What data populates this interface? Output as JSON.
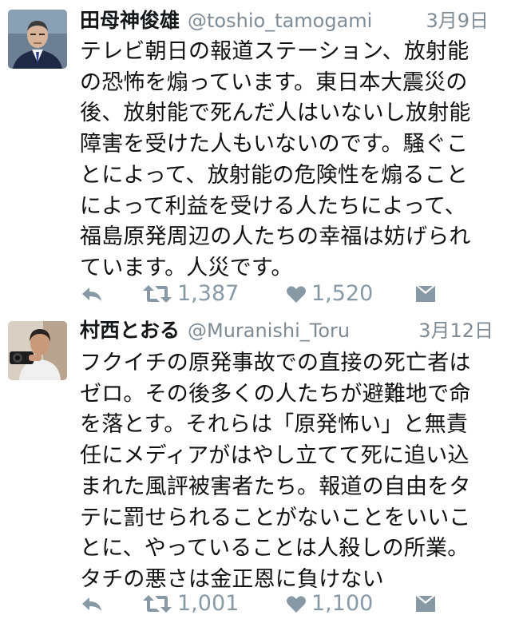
{
  "tweets": [
    {
      "name": "田母神俊雄",
      "handle": "@toshio_tamogami",
      "date": "3月9日",
      "body_lines": [
        "テレビ朝日の報道ステーション、放射能",
        "の恐怖を煽っています。東日本大震災の",
        "後、放射能で死んだ人はいないし放射能",
        "障害を受けた人もいないのです。騒ぐこ",
        "とによって、放射能の危険性を煽ること",
        "によって利益を受ける人たちによって、",
        "福島原発周辺の人たちの幸福は妨げられ",
        "ています。人災です。"
      ],
      "retweets": "1,387",
      "likes": "1,520"
    },
    {
      "name": "村西とおる",
      "handle": "@Muranishi_Toru",
      "date": "3月12日",
      "body_lines": [
        "フクイチの原発事故での直接の死亡者は",
        "ゼロ。その後多くの人たちが避難地で命",
        "を落とす。それらは「原発怖い」と無責",
        "任にメディアがはやし立てて死に追い込",
        "まれた風評被害者たち。報道の自由をタ",
        "テに罰せられることがないことをいいこ",
        "とに、やっていることは人殺しの所業。",
        "タチの悪さは金正恩に負けない"
      ],
      "retweets": "1,001",
      "likes": "1,100"
    }
  ],
  "colors": {
    "name": "#14171a",
    "meta": "#7f8b95",
    "action_icon": "#8899a6",
    "body": "#111111"
  },
  "icons": {
    "reply": "reply-arrow-icon",
    "retweet": "retweet-icon",
    "like": "heart-icon",
    "dm": "envelope-icon"
  }
}
